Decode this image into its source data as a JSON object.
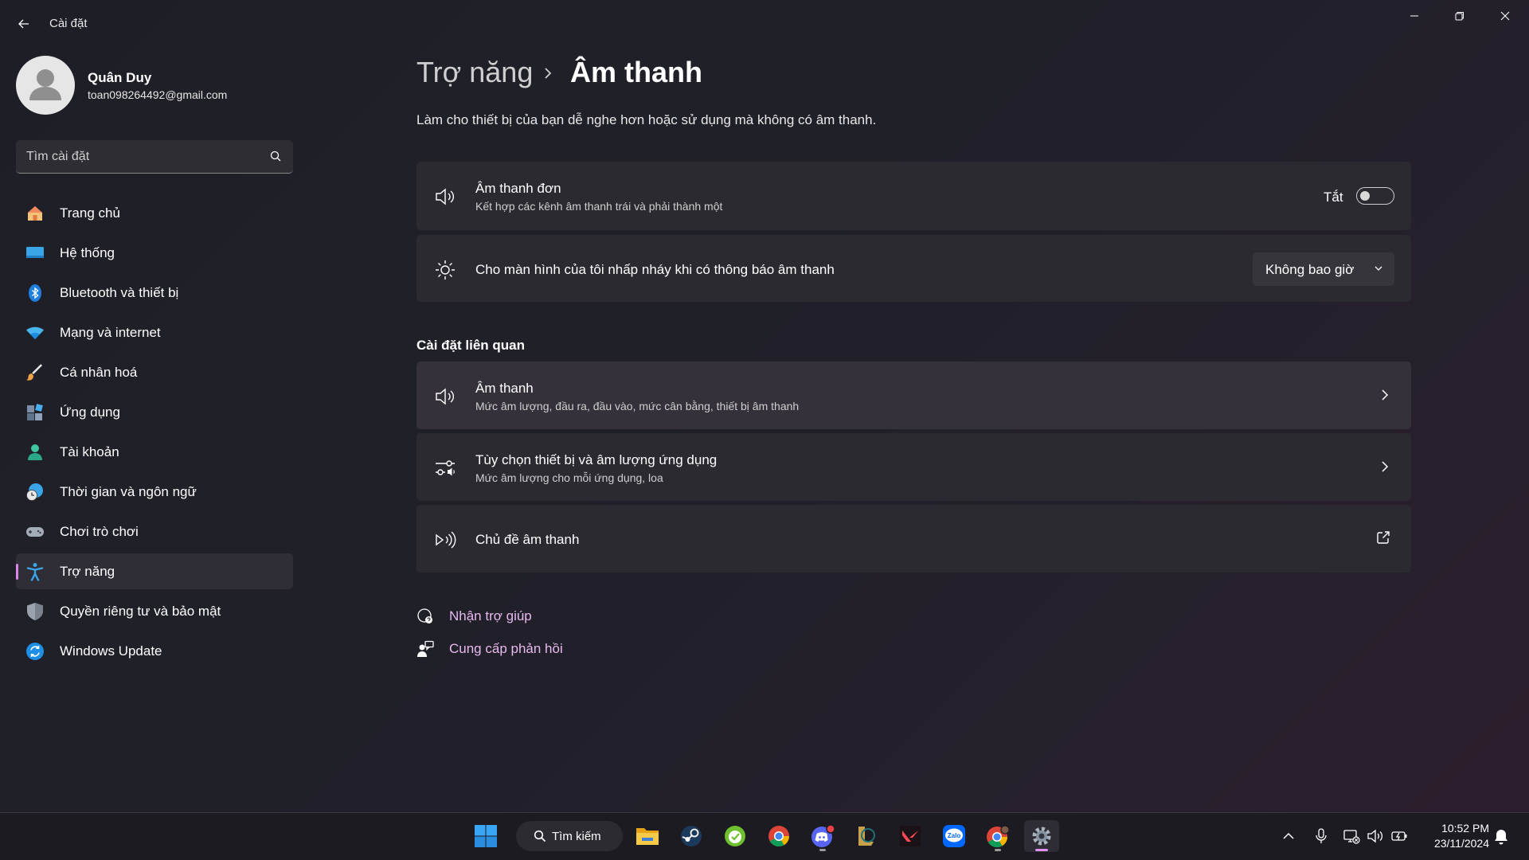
{
  "window": {
    "title": "Cài đặt",
    "controls": [
      "minimize",
      "restore",
      "close"
    ]
  },
  "profile": {
    "name": "Quân Duy",
    "email": "toan098264492@gmail.com"
  },
  "search": {
    "placeholder": "Tìm cài đặt"
  },
  "sidebar": {
    "items": [
      {
        "label": "Trang chủ",
        "icon": "home-icon"
      },
      {
        "label": "Hệ thống",
        "icon": "system-icon"
      },
      {
        "label": "Bluetooth và thiết bị",
        "icon": "bluetooth-icon"
      },
      {
        "label": "Mạng và internet",
        "icon": "wifi-icon"
      },
      {
        "label": "Cá nhân hoá",
        "icon": "brush-icon"
      },
      {
        "label": "Ứng dụng",
        "icon": "apps-icon"
      },
      {
        "label": "Tài khoản",
        "icon": "account-icon"
      },
      {
        "label": "Thời gian và ngôn ngữ",
        "icon": "time-language-icon"
      },
      {
        "label": "Chơi trò chơi",
        "icon": "gamepad-icon"
      },
      {
        "label": "Trợ năng",
        "icon": "accessibility-icon",
        "active": true
      },
      {
        "label": "Quyền riêng tư và bảo mật",
        "icon": "shield-icon"
      },
      {
        "label": "Windows Update",
        "icon": "update-icon"
      }
    ]
  },
  "breadcrumb": {
    "parent": "Trợ năng",
    "current": "Âm thanh"
  },
  "page": {
    "description": "Làm cho thiết bị của bạn dễ nghe hơn hoặc sử dụng mà không có âm thanh."
  },
  "settings": {
    "mono_audio": {
      "title": "Âm thanh đơn",
      "subtitle": "Kết hợp các kênh âm thanh trái và phải thành một",
      "state_label": "Tắt",
      "enabled": false
    },
    "flash_screen": {
      "title": "Cho màn hình của tôi nhấp nháy khi có thông báo âm thanh",
      "dropdown_value": "Không bao giờ"
    }
  },
  "related": {
    "title": "Cài đặt liên quan",
    "items": [
      {
        "title": "Âm thanh",
        "subtitle": "Mức âm lượng, đầu ra, đầu vào, mức cân bằng, thiết bị âm thanh",
        "icon": "speaker-icon"
      },
      {
        "title": "Tùy chọn thiết bị và âm lượng ứng dụng",
        "subtitle": "Mức âm lượng cho mỗi ứng dụng, loa",
        "icon": "mixer-icon"
      },
      {
        "title": "Chủ đề âm thanh",
        "subtitle": "",
        "icon": "sound-theme-icon"
      }
    ]
  },
  "links": {
    "help": "Nhận trợ giúp",
    "feedback": "Cung cấp phản hồi"
  },
  "taskbar": {
    "search_label": "Tìm kiếm",
    "apps": [
      "start-icon",
      "file-explorer-icon",
      "steam-icon",
      "app-green-icon",
      "chrome-icon",
      "discord-icon",
      "league-icon",
      "valorant-icon",
      "zalo-icon",
      "chrome-profile-icon",
      "settings-icon"
    ],
    "time": "10:52 PM",
    "date": "23/11/2024"
  },
  "colors": {
    "accent": "#e8b9ef",
    "indicator": "#d887e6",
    "card": "#2c2a31",
    "background": "#202027"
  }
}
